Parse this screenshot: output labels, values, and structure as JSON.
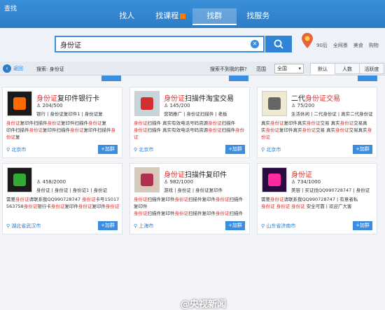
{
  "app": {
    "logo": "查找"
  },
  "nav": {
    "tabs": [
      "找人",
      "找课程",
      "找群",
      "找服务"
    ],
    "active_index": 2
  },
  "search": {
    "query": "身份证",
    "clear_icon": "clear-icon",
    "search_icon": "search-icon"
  },
  "weather": {
    "temp": "90后",
    "items": [
      "全网景",
      "美食",
      "购物"
    ]
  },
  "filter": {
    "back_label": "返回",
    "search_label": "搜索: 身份证",
    "hint": "搜索不到我的群?",
    "range_label": "范围",
    "range_value": "全国",
    "sort_tabs": [
      "默认",
      "人数",
      "活跃度"
    ]
  },
  "cards": [
    {
      "title_hl": "身份证",
      "title_rest": "复印件银行卡",
      "members": "204/500",
      "tags": "银行 | 身份证复印件1 | 身份证复",
      "desc": [
        "身份证复印件扫描件身份证复印件扫描件身份证复",
        "印件扫描件身份证复印件扫描件身份证复印件扫描件身份证复",
        "身份证"
      ],
      "location": "北京市",
      "join": "+加群",
      "icon_colors": [
        "#1a1a1a",
        "#ff6a00"
      ]
    },
    {
      "title_hl": "身份证",
      "title_rest": "扫描件淘宝交易",
      "members": "145/200",
      "tags": "营销推广 | 身份证扫描件 | 老板",
      "desc": [
        "身份证扫描件 真实有效电话号码资源身份证扫描件",
        "身份证扫描件 真实有效电话号码资源身份证扫描件身份证"
      ],
      "location": "北京市",
      "join": "+加群",
      "icon_colors": [
        "#c8d4dc",
        "#d23030"
      ]
    },
    {
      "title_hl": "二代",
      "title_rest": "身份证交易",
      "title_prefix_plain": true,
      "members": "75/200",
      "tags": "生活休闲 | 二代身份证 | 真实二代身份证",
      "desc": [
        "真实身份证复印件真实身份证交易 真实身份证交易真",
        "实身份证复印件真实身份证交易 真实身份证交易真实身份证",
        "复印件真实身份证交易"
      ],
      "location": "北京市",
      "join": "+加群",
      "icon_colors": [
        "#f1ead2",
        "#666666"
      ]
    },
    {
      "title_hl": "",
      "title_rest": "",
      "members": "458/2000",
      "tags": "身份证 | 身份证 | 身份证1 | 身份证",
      "desc": [
        "需要身份证请联系我QQ990728747 身份证卡号15017",
        "563758身份证银行卡身份证复印件身份证复印件身份证"
      ],
      "location": "湖北省武汉市",
      "join": "+加群",
      "icon_colors": [
        "#1a1a1a",
        "#33aa33"
      ]
    },
    {
      "title_hl": "身份证",
      "title_rest": "扫描件复印件",
      "members": "982/1000",
      "tags": "游戏 | 身份证 | 身份证复印件",
      "desc": [
        "身份证扫描件复印件身份证扫描件复印件身份证扫描件复印件",
        "身份证扫描件复印件身份证扫描件复印件身份证扫描件复印件"
      ],
      "location": "上海市",
      "join": "+加群",
      "icon_colors": [
        "#d8c8b8",
        "#b03050"
      ]
    },
    {
      "title_hl": "身份证",
      "title_rest": "",
      "members": "734/1000",
      "tags": "美容 | 买证找QQ990728747 | 身份证",
      "desc": [
        "需要身份证请联系我QQ990728747 | 有意者私",
        "身份证 身份证 身份证 安全可靠 | 欢迎广大客"
      ],
      "location": "山东省济南市",
      "join": "+加群",
      "icon_colors": [
        "#2a0a40",
        "#ff2aa0"
      ]
    }
  ],
  "watermark": "@央视新闻"
}
